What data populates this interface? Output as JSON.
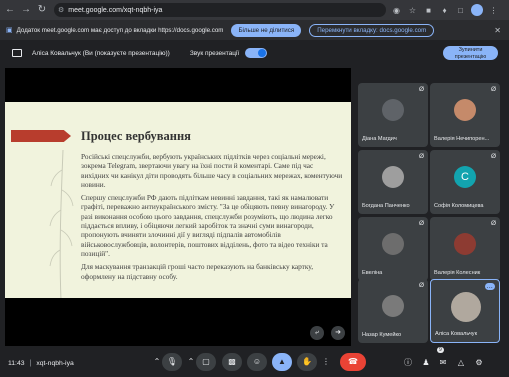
{
  "browser": {
    "url": "meet.google.com/xqt-nqbh-iya"
  },
  "share_banner": {
    "text": "Додаток meet.google.com має доступ до вкладки https://docs.google.com",
    "primary_label": "Більше не ділитися",
    "secondary_label": "Перемкнути вкладку: docs.google.com"
  },
  "presentation_bar": {
    "presenter": "Аліса Ковальчук (Ви (показуєте презентацію))",
    "sound_label": "Звук презентації",
    "stop_label": "Зупинити презентацію"
  },
  "slide": {
    "title": "Процес вербування",
    "paragraphs": [
      "Російські спецслужби, вербують українських підлітків через соціальні мережі, зокрема Telegram, звертаючи увагу на їхні пости й коментарі. Саме під час вихідних чи канікул діти проводять більше часу в соціальних мережах, коментуючи новини.",
      "Спершу спецслужби РФ дають підліткам невинні завдання, такі як намалювати графіті, переважно антиукраїнського змісту. \"За це обіцяють певну винагороду. У разі виконання особою цього завдання, спецслужби розуміють, що людина легко піддається впливу, і обіцяючи легкий заробіток та значні суми винагороди, пропонують вчиняти злочинні дії у вигляді підпалів автомобілів військовослужбовців, волонтерів, поштових відділень, фото та відео техніки та позицій\".",
      "Для маскування транзакцій гроші часто переказують на банківську картку, оформлену на підставну особу."
    ]
  },
  "participants": [
    {
      "name": "Діана Магдич",
      "initial": "",
      "color": "#5f6368"
    },
    {
      "name": "Валерія Нечипорен...",
      "initial": "",
      "color": "#c58a6a"
    },
    {
      "name": "Богдана Панченко",
      "initial": "",
      "color": "#9e9e9e"
    },
    {
      "name": "Софія Коломицева",
      "initial": "С",
      "color": "#12a4af"
    },
    {
      "name": "Евеліна",
      "initial": "",
      "color": "#6d6d6d"
    },
    {
      "name": "Валерія Колесник",
      "initial": "",
      "color": "#8d3b32"
    },
    {
      "name": "Назар Кумейко",
      "initial": "",
      "color": "#7a7a7a"
    },
    {
      "name": "Аліса Ковальчук",
      "initial": "",
      "color": "#b0a89e"
    }
  ],
  "bottom": {
    "time": "11:43",
    "code": "xqt-nqbh-iya",
    "participant_count": "9"
  },
  "colors": {
    "accent": "#8ab4f8",
    "end_call": "#ea4335",
    "tile": "#3c4043",
    "slide_bg": "#f1f3dd",
    "slide_accent": "#b83d2d"
  }
}
